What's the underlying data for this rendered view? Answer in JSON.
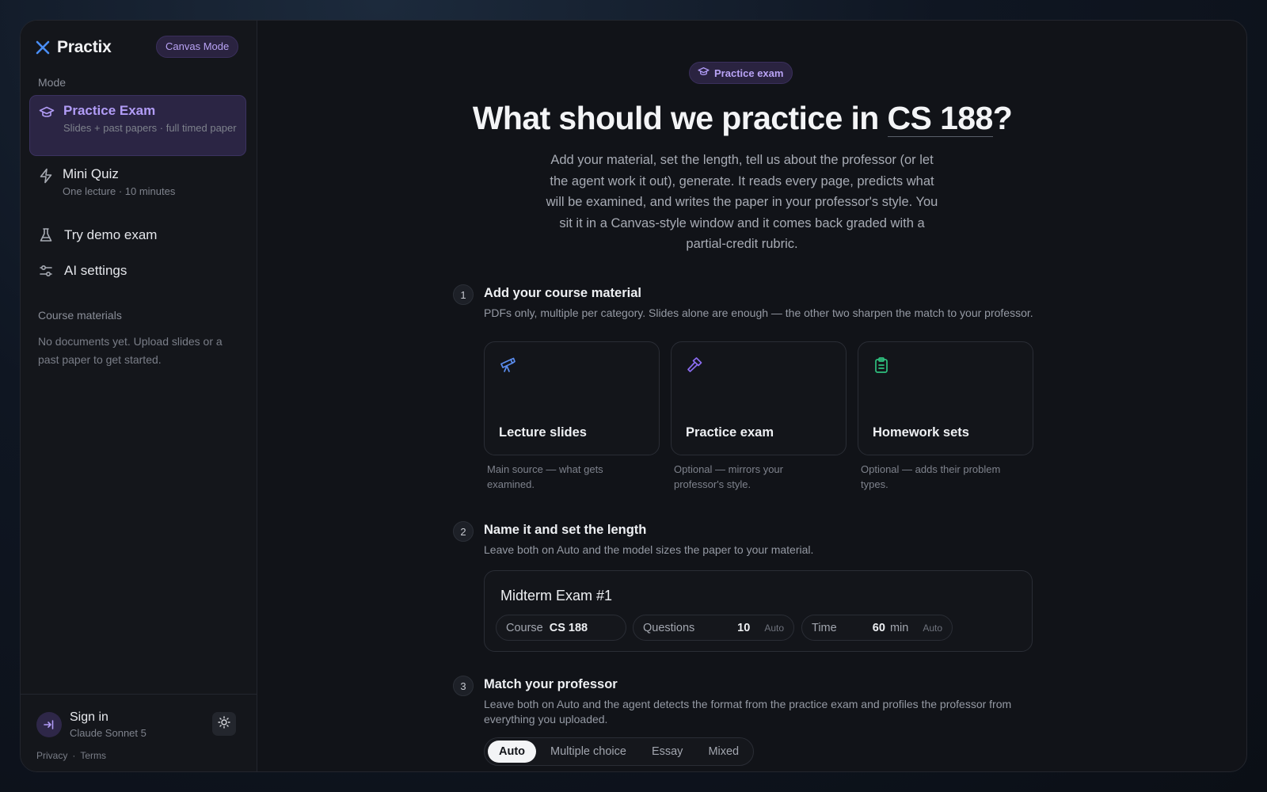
{
  "app": {
    "name": "Practix",
    "canvas_mode_label": "Canvas Mode"
  },
  "sidebar": {
    "mode_label": "Mode",
    "modes": [
      {
        "title": "Practice Exam",
        "subtitle": "Slides + past papers · full timed paper",
        "icon": "graduation-cap-icon",
        "active": true
      },
      {
        "title": "Mini Quiz",
        "subtitle": "One lecture · 10 minutes",
        "icon": "lightning-icon",
        "active": false
      }
    ],
    "nav": [
      {
        "label": "Try demo exam",
        "icon": "flask-icon"
      },
      {
        "label": "AI settings",
        "icon": "sliders-icon"
      }
    ],
    "materials_label": "Course materials",
    "materials_empty": "No documents yet. Upload slides or a past paper to get started.",
    "footer": {
      "signin_title": "Sign in",
      "signin_sub": "Claude Sonnet 5",
      "privacy": "Privacy",
      "separator": "·",
      "terms": "Terms"
    }
  },
  "main": {
    "pill_label": "Practice exam",
    "headline_prefix": "What should we practice in ",
    "headline_course": "CS 188",
    "headline_suffix": "?",
    "lead": "Add your material, set the length, tell us about the professor (or let the agent work it out), generate. It reads every page, predicts what will be examined, and writes the paper in your professor's style. You sit it in a Canvas-style window and it comes back graded with a partial-credit rubric.",
    "steps": [
      {
        "num": "1",
        "title": "Add your course material",
        "desc": "PDFs only, multiple per category. Slides alone are enough — the other two sharpen the match to your professor.",
        "cards": [
          {
            "title": "Lecture slides",
            "note": "Main source — what gets examined.",
            "icon": "telescope-icon",
            "color": "#5b8def"
          },
          {
            "title": "Practice exam",
            "note": "Optional — mirrors your professor's style.",
            "icon": "hammer-icon",
            "color": "#8b6cf0"
          },
          {
            "title": "Homework sets",
            "note": "Optional — adds their problem types.",
            "icon": "clipboard-icon",
            "color": "#2fbf7e"
          }
        ]
      },
      {
        "num": "2",
        "title": "Name it and set the length",
        "desc": "Leave both on Auto and the model sizes the paper to your material.",
        "exam_name": "Midterm Exam #1",
        "course_label": "Course",
        "course_value": "CS 188",
        "questions_label": "Questions",
        "questions_value": "10",
        "questions_auto": "Auto",
        "time_label": "Time",
        "time_value": "60",
        "time_unit": "min",
        "time_auto": "Auto"
      },
      {
        "num": "3",
        "title": "Match your professor",
        "desc": "Leave both on Auto and the agent detects the format from the practice exam and profiles the professor from everything you uploaded.",
        "formats": [
          "Auto",
          "Multiple choice",
          "Essay",
          "Mixed"
        ],
        "selected_format": "Auto"
      }
    ]
  }
}
